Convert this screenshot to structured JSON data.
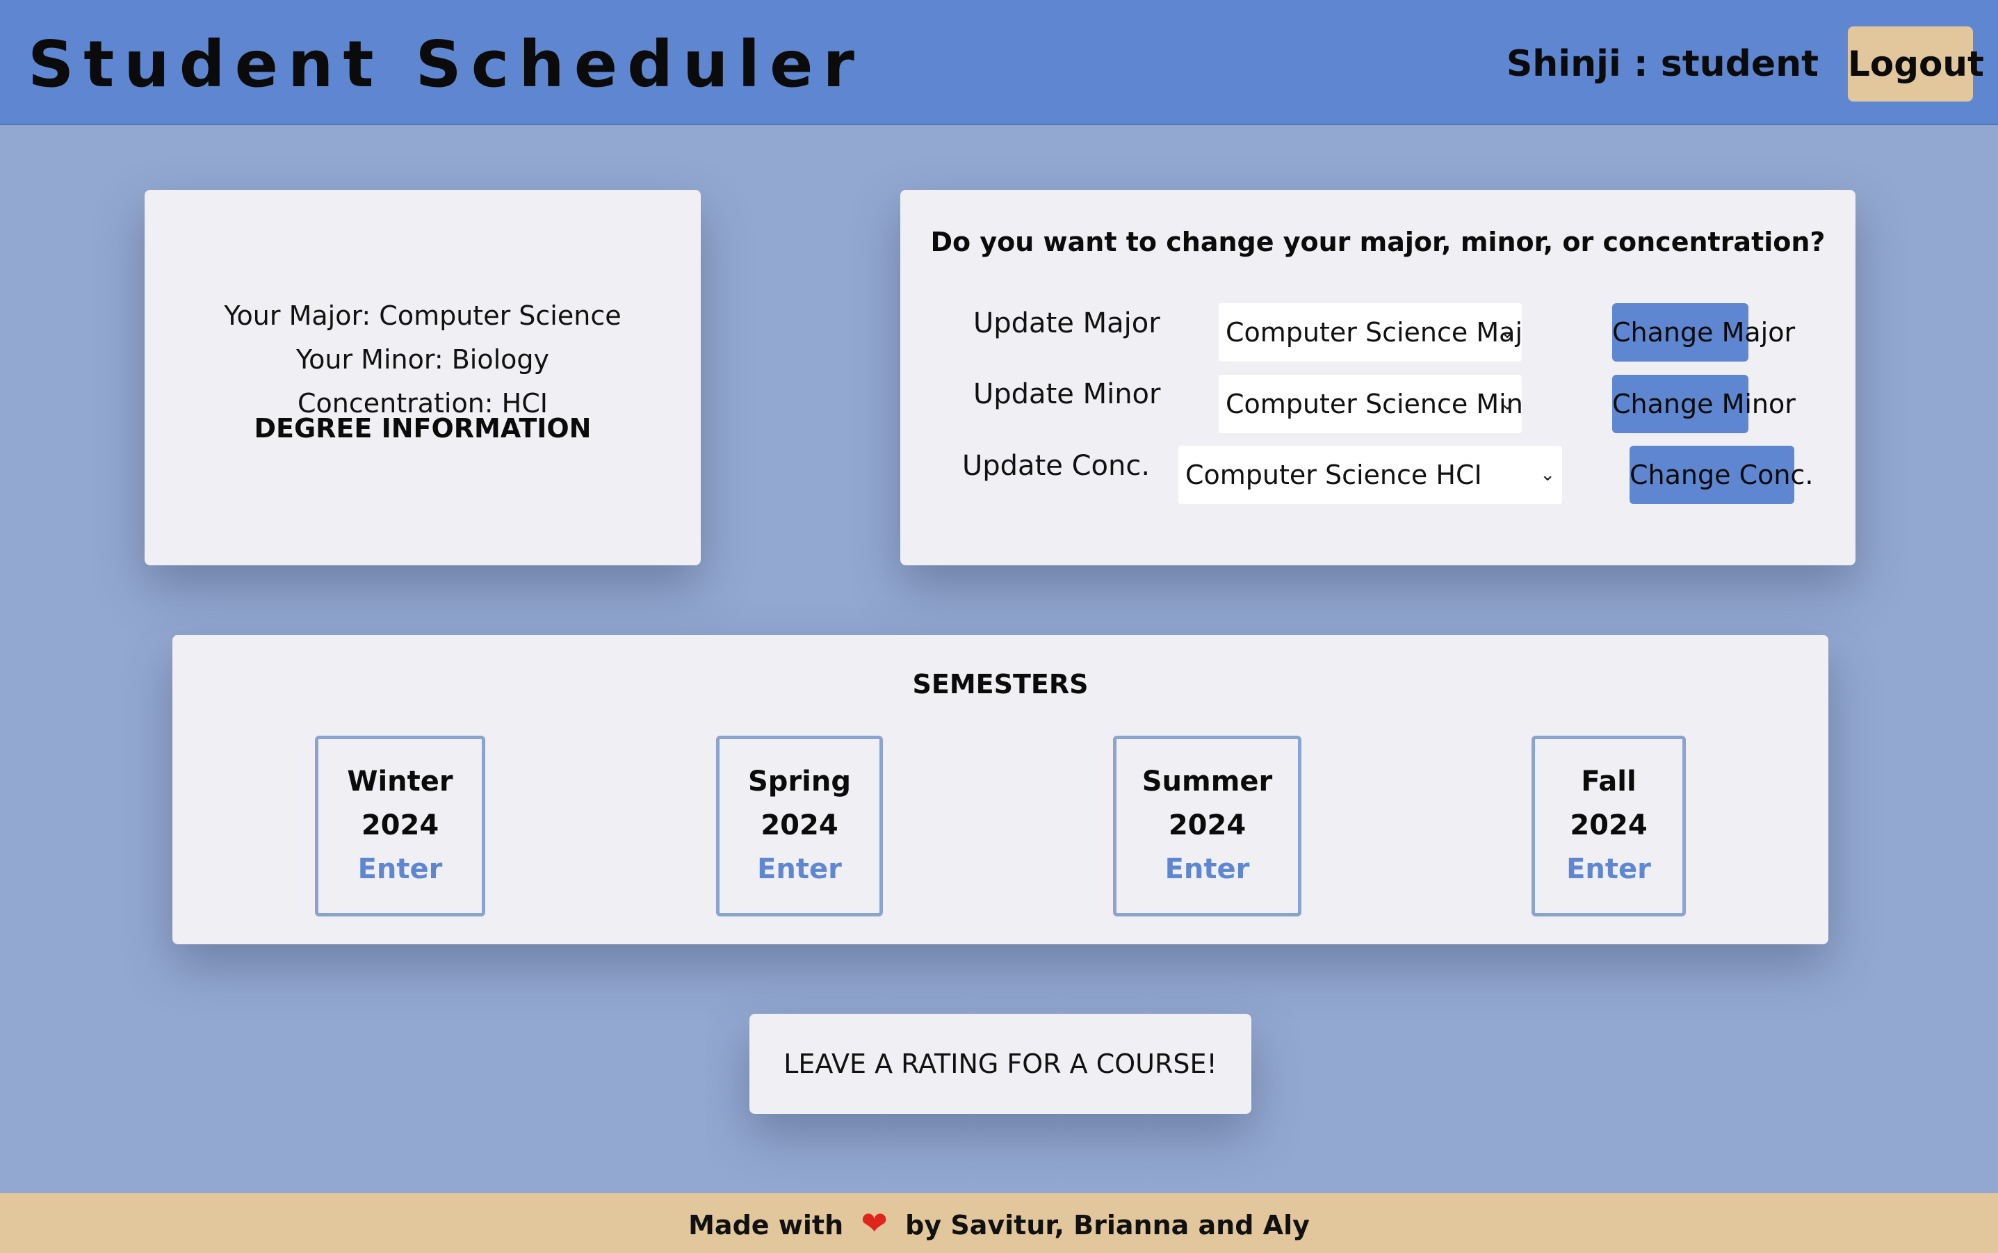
{
  "header": {
    "title": "Student Scheduler",
    "user": "Shinji : student",
    "logout_label": "Logout"
  },
  "degree": {
    "heading": "DEGREE INFORMATION",
    "major_line": "Your Major: Computer Science",
    "minor_line": "Your Minor: Biology",
    "concentration_line": "Concentration: HCI"
  },
  "change": {
    "heading": "Do you want to change your major, minor, or concentration?",
    "rows": [
      {
        "label": "Update Major",
        "selected": "Computer Science Major",
        "button": "Change Major"
      },
      {
        "label": "Update Minor",
        "selected": "Computer Science Minor",
        "button": "Change Minor"
      },
      {
        "label": "Update Conc.",
        "selected": "Computer Science HCI",
        "button": "Change Conc."
      }
    ]
  },
  "semesters": {
    "heading": "SEMESTERS",
    "items": [
      {
        "season": "Winter",
        "year": "2024",
        "action": "Enter"
      },
      {
        "season": "Spring",
        "year": "2024",
        "action": "Enter"
      },
      {
        "season": "Summer",
        "year": "2024",
        "action": "Enter"
      },
      {
        "season": "Fall",
        "year": "2024",
        "action": "Enter"
      }
    ]
  },
  "rating": {
    "label": "LEAVE A RATING FOR A COURSE!"
  },
  "footer": {
    "prefix": "Made with",
    "icon": "heart-icon",
    "suffix": "by Savitur, Brianna and Aly"
  },
  "colors": {
    "header_bg": "#5f87d1",
    "page_bg": "#93a8d0",
    "card_bg": "#f0f0f4",
    "accent_tan": "#e2c79c",
    "heart": "#e0251c"
  }
}
